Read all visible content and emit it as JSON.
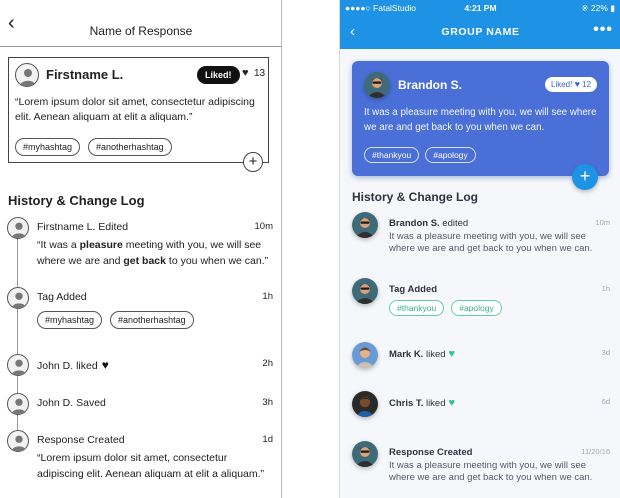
{
  "wireframe": {
    "header": {
      "back_icon": "chevron-left-icon",
      "title": "Name of Response"
    },
    "card": {
      "name": "Firstname L.",
      "liked_label": "Liked!",
      "like_count": "13",
      "text": "“Lorem ipsum dolor sit amet, consectetur adipiscing elit. Aenean aliquam at elit a aliquam.”",
      "hashtags": [
        "#myhashtag",
        "#anotherhashtag"
      ]
    },
    "section_title": "History & Change Log",
    "log": [
      {
        "title": "Firstname L. Edited",
        "time": "10m",
        "text_before": "“It was a ",
        "bold1": "pleasure",
        "text_mid": " meeting with you, we will see where we are and ",
        "bold2": "get back",
        "text_after": " to you when we can.”"
      },
      {
        "title": "Tag Added",
        "time": "1h",
        "hashtags": [
          "#myhashtag",
          "#anotherhashtag"
        ]
      },
      {
        "title": "John D. liked",
        "time": "2h"
      },
      {
        "title": "John D. Saved",
        "time": "3h"
      },
      {
        "title": "Response Created",
        "time": "1d",
        "text": "“Lorem ipsum dolor sit amet, consectetur adipiscing elit. Aenean aliquam at elit a aliquam.”"
      }
    ]
  },
  "mobile": {
    "status": {
      "carrier": "●●●●○ FatalStudio",
      "time": "4:21 PM",
      "battery": "22%"
    },
    "nav": {
      "title": "GROUP NAME"
    },
    "card": {
      "name": "Brandon S.",
      "liked_label": "Liked!",
      "like_count": "12",
      "text": "It was a pleasure meeting with you, we will see where we are and get back to you when we can.",
      "hashtags": [
        "#thankyou",
        "#apology"
      ]
    },
    "section_title": "History & Change Log",
    "log": [
      {
        "name": "Brandon S.",
        "action": " edited",
        "time": "10m",
        "text": "It was a pleasure meeting with you, we will see where we are and get back to you when we can."
      },
      {
        "name": "Tag Added",
        "action": "",
        "time": "1h",
        "hashtags": [
          "#thankyou",
          "#apology"
        ]
      },
      {
        "name": "Mark K.",
        "action": " liked",
        "time": "3d"
      },
      {
        "name": "Chris T.",
        "action": " liked",
        "time": "6d"
      },
      {
        "name": "Response Created",
        "action": "",
        "time": "11/20/16",
        "text": "It was a pleasure meeting with you, we will see where we are and get back to you when we can."
      }
    ],
    "colors": {
      "primary": "#1e93e6",
      "card": "#4a6fd6",
      "tag_green": "#33c48d"
    }
  }
}
